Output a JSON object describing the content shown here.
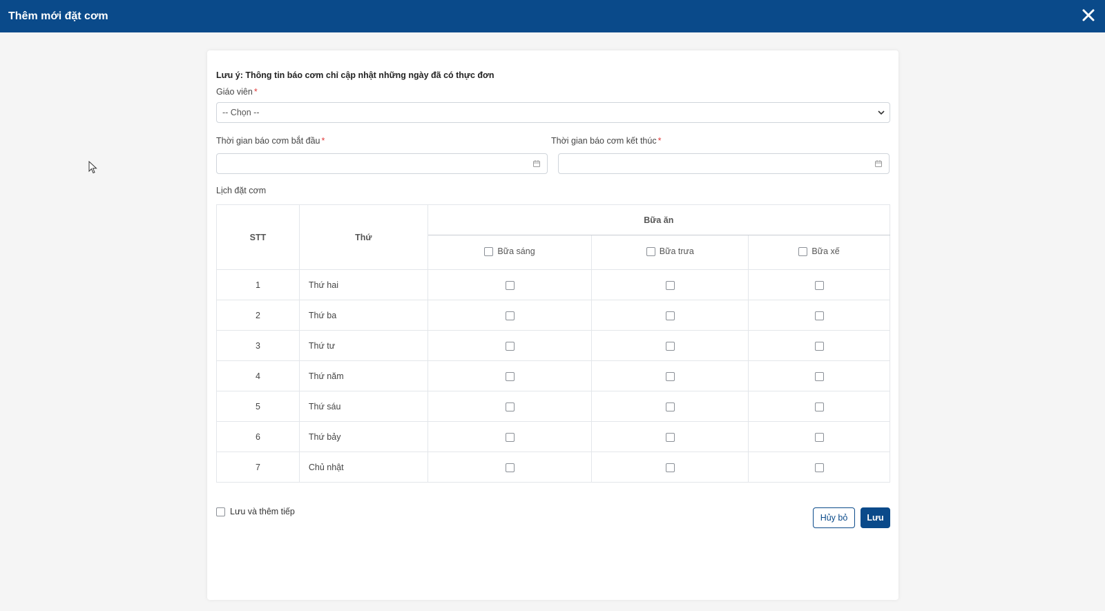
{
  "dialog": {
    "title": "Thêm mới đặt cơm",
    "close_icon": "close-icon"
  },
  "form": {
    "note": "Lưu ý: Thông tin báo cơm chỉ cập nhật những ngày đã có thực đơn",
    "teacher": {
      "label": "Giáo viên",
      "required": "*",
      "selected": "-- Chọn --"
    },
    "start_date": {
      "label": "Thời gian báo cơm bắt đầu",
      "required": "*",
      "value": ""
    },
    "end_date": {
      "label": "Thời gian báo cơm kết thúc",
      "required": "*",
      "value": ""
    },
    "schedule_label": "Lịch đặt cơm"
  },
  "table": {
    "col_stt": "STT",
    "col_day": "Thứ",
    "col_meals": "Bữa ăn",
    "meals": [
      "Bữa sáng",
      "Bữa trưa",
      "Bữa xế"
    ],
    "rows": [
      {
        "stt": "1",
        "day": "Thứ hai"
      },
      {
        "stt": "2",
        "day": "Thứ ba"
      },
      {
        "stt": "3",
        "day": "Thứ tư"
      },
      {
        "stt": "4",
        "day": "Thứ năm"
      },
      {
        "stt": "5",
        "day": "Thứ sáu"
      },
      {
        "stt": "6",
        "day": "Thứ bảy"
      },
      {
        "stt": "7",
        "day": "Chủ nhật"
      }
    ]
  },
  "footer": {
    "save_and_continue": "Lưu và thêm tiếp",
    "cancel": "Hủy bỏ",
    "save": "Lưu"
  },
  "colors": {
    "primary": "#0a4a8a",
    "required": "#e03a3a"
  }
}
